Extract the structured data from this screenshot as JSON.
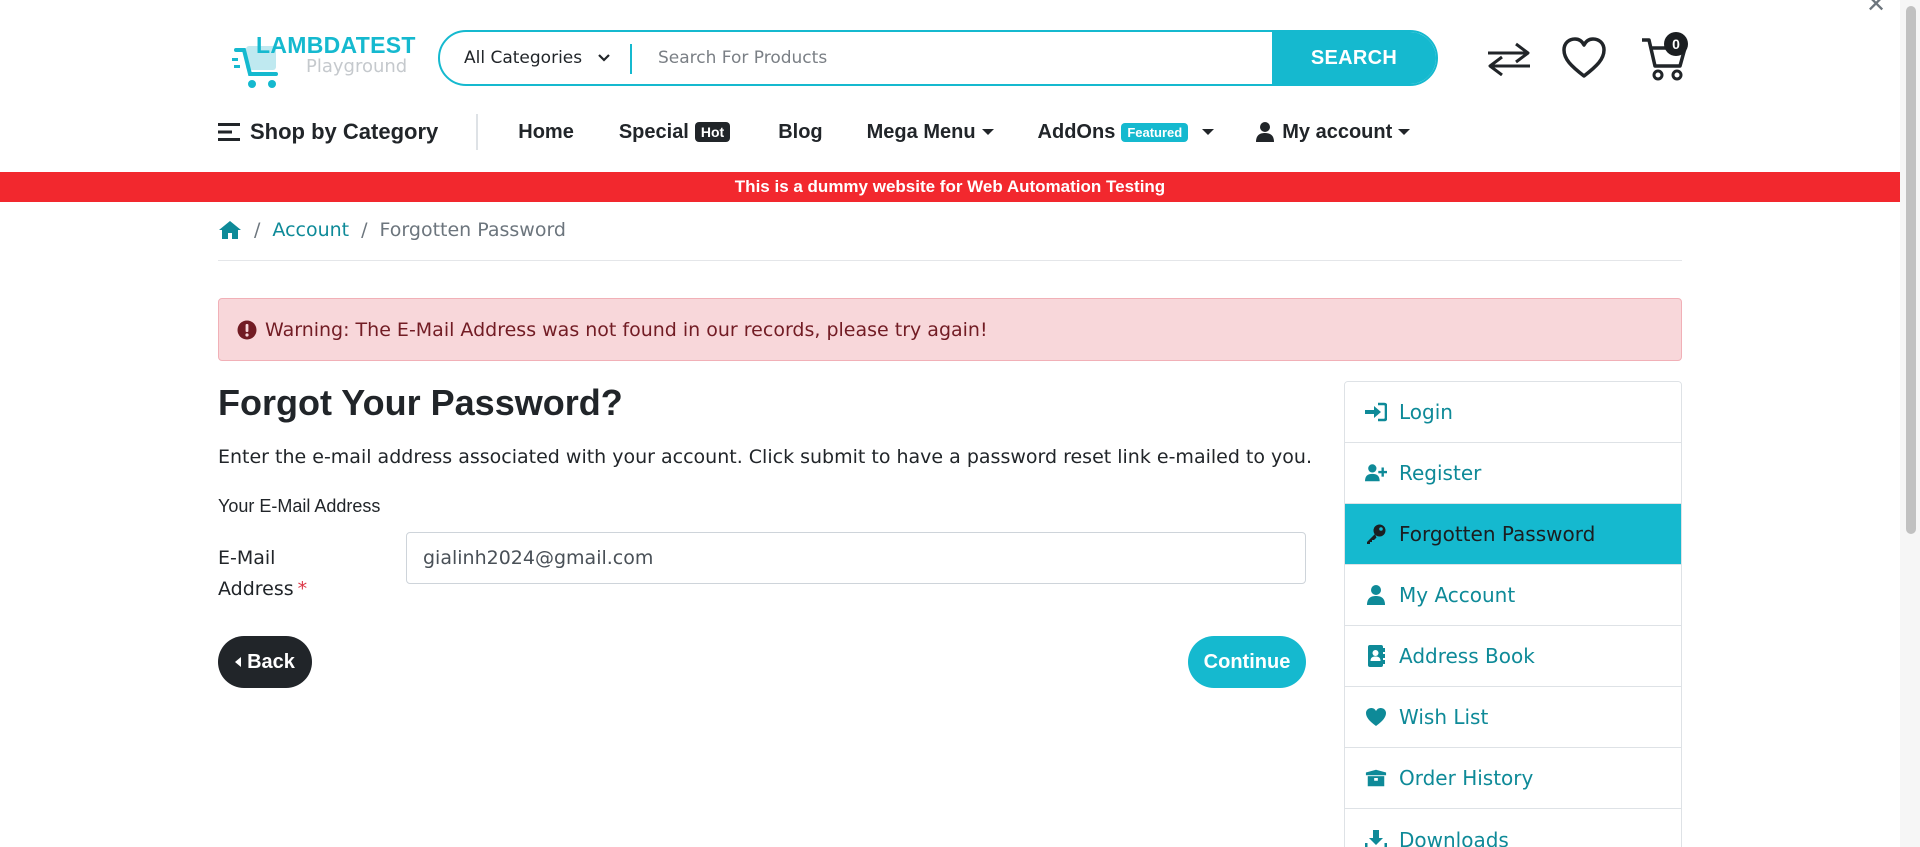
{
  "logo": {
    "word": "LAMBDATEST",
    "sub": "Playground"
  },
  "search": {
    "category_selected": "All Categories",
    "placeholder": "Search For Products",
    "button": "SEARCH"
  },
  "header_icons": [
    "compare-icon",
    "heart-icon",
    "cart-icon"
  ],
  "cart": {
    "count": "0"
  },
  "nav": {
    "shop_by_category": "Shop by Category",
    "home": "Home",
    "special": "Special",
    "special_badge": "Hot",
    "blog": "Blog",
    "mega_menu": "Mega Menu",
    "addons": "AddOns",
    "addons_badge": "Featured",
    "my_account": "My account"
  },
  "banner": "This is a dummy website for Web Automation Testing",
  "breadcrumb": {
    "account": "Account",
    "current": "Forgotten Password"
  },
  "alert": {
    "text": "Warning: The E-Mail Address was not found in our records, please try again!"
  },
  "form": {
    "title": "Forgot Your Password?",
    "intro": "Enter the e-mail address associated with your account. Click submit to have a password reset link e-mailed to you.",
    "legend": "Your E-Mail Address",
    "email_label": "E-Mail Address",
    "required_mark": "*",
    "email_value": "gialinh2024@gmail.com",
    "back": "Back",
    "continue": "Continue"
  },
  "sidebar": {
    "items": [
      {
        "label": "Login",
        "icon": "sign-in-icon"
      },
      {
        "label": "Register",
        "icon": "user-plus-icon"
      },
      {
        "label": "Forgotten Password",
        "icon": "key-icon",
        "active": true
      },
      {
        "label": "My Account",
        "icon": "user-icon"
      },
      {
        "label": "Address Book",
        "icon": "address-book-icon"
      },
      {
        "label": "Wish List",
        "icon": "heart-icon"
      },
      {
        "label": "Order History",
        "icon": "box-icon"
      },
      {
        "label": "Downloads",
        "icon": "download-icon"
      }
    ]
  },
  "colors": {
    "accent": "#15b9cf",
    "link": "#0e8a98",
    "banner": "#f2282e",
    "alert_bg": "#f8d7da",
    "dark": "#212529"
  }
}
